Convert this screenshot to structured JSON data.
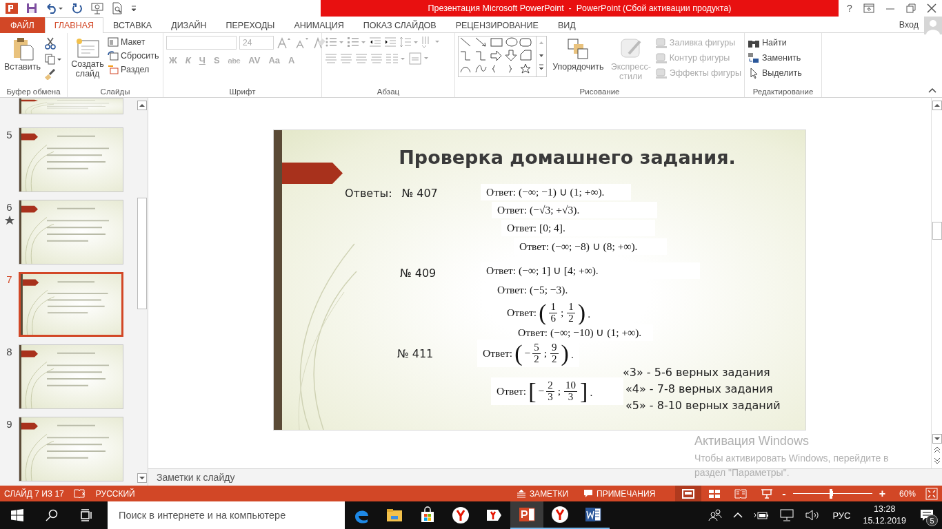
{
  "title_bar": {
    "title": "Презентация Microsoft PowerPoint  -  PowerPoint (Сбой активации продукта)",
    "help": "?"
  },
  "tabs": [
    {
      "label": "ФАЙЛ",
      "kind": "file",
      "selected": false
    },
    {
      "label": "ГЛАВНАЯ",
      "kind": "tab",
      "selected": true
    },
    {
      "label": "ВСТАВКА",
      "kind": "tab",
      "selected": false
    },
    {
      "label": "ДИЗАЙН",
      "kind": "tab",
      "selected": false
    },
    {
      "label": "ПЕРЕХОДЫ",
      "kind": "tab",
      "selected": false
    },
    {
      "label": "АНИМАЦИЯ",
      "kind": "tab",
      "selected": false
    },
    {
      "label": "ПОКАЗ СЛАЙДОВ",
      "kind": "tab",
      "selected": false
    },
    {
      "label": "РЕЦЕНЗИРОВАНИЕ",
      "kind": "tab",
      "selected": false
    },
    {
      "label": "ВИД",
      "kind": "tab",
      "selected": false
    }
  ],
  "account": {
    "label": "Вход"
  },
  "ribbon": {
    "clipboard": {
      "label": "Буфер обмена",
      "paste": "Вставить"
    },
    "slides": {
      "label": "Слайды",
      "new_slide": "Создать слайд",
      "layout": "Макет",
      "reset": "Сбросить",
      "section": "Раздел"
    },
    "font": {
      "label": "Шрифт",
      "disabled": true,
      "size": "24",
      "buttons": [
        "Ж",
        "К",
        "Ч",
        "S",
        "abc",
        "AV",
        "Aa",
        "A"
      ]
    },
    "paragraph": {
      "label": "Абзац",
      "disabled": true
    },
    "drawing": {
      "label": "Рисование",
      "arrange": "Упорядочить",
      "quick_styles": {
        "label": "Экспресс-стили",
        "disabled": true
      },
      "shape_tools": [
        {
          "label": "Заливка фигуры",
          "disabled": true
        },
        {
          "label": "Контур фигуры",
          "disabled": true
        },
        {
          "label": "Эффекты фигуры",
          "disabled": true
        }
      ]
    },
    "editing": {
      "label": "Редактирование",
      "find": "Найти",
      "replace": "Заменить",
      "select": "Выделить"
    }
  },
  "thumbnails": [
    {
      "kind": "partial",
      "selected": false
    },
    {
      "kind": "full",
      "number": "5",
      "animated": false,
      "selected": false
    },
    {
      "kind": "full",
      "number": "6",
      "animated": true,
      "selected": false
    },
    {
      "kind": "full",
      "number": "7",
      "animated": false,
      "selected": true
    },
    {
      "kind": "full",
      "number": "8",
      "animated": false,
      "selected": false
    },
    {
      "kind": "full",
      "number": "9",
      "animated": false,
      "selected": false
    }
  ],
  "slide": {
    "title": "Проверка домашнего задания.",
    "tasks": [
      {
        "prefix": "Ответы:",
        "number": "№ 407",
        "answers": [
          {
            "kind": "text",
            "text": "Ответ: (−∞; −1) ∪ (1; +∞)."
          },
          {
            "kind": "text",
            "text": "Ответ: (−√3; +√3)."
          },
          {
            "kind": "text",
            "text": "Ответ: [0; 4]."
          },
          {
            "kind": "text",
            "text": "Ответ: (−∞; −8) ∪ (8; +∞)."
          }
        ]
      },
      {
        "number": "№ 409",
        "answers": [
          {
            "kind": "text",
            "text": "Ответ: (−∞; 1] ∪ [4; +∞)."
          },
          {
            "kind": "text",
            "text": "Ответ: (−5; −3)."
          },
          {
            "kind": "fraction",
            "label": "Ответ:",
            "open": "(",
            "terms": [
              {
                "num": "1",
                "den": "6"
              },
              {
                "num": "1",
                "den": "2"
              }
            ],
            "separator": ";",
            "close": ")",
            "end": "."
          },
          {
            "kind": "text",
            "text": "Ответ: (−∞; −10) ∪ (1; +∞)."
          }
        ]
      },
      {
        "number": "№ 411",
        "answers": [
          {
            "kind": "fraction",
            "label": "Ответ:",
            "open": "(",
            "terms": [
              {
                "sign": "−",
                "num": "5",
                "den": "2"
              },
              {
                "num": "9",
                "den": "2"
              }
            ],
            "separator": ";",
            "close": ")",
            "end": "."
          },
          {
            "kind": "fraction",
            "label": "Ответ:",
            "open": "[",
            "terms": [
              {
                "sign": "−",
                "num": "2",
                "den": "3"
              },
              {
                "num": "10",
                "den": "3"
              }
            ],
            "separator": ";",
            "close": "]",
            "end": "."
          }
        ]
      }
    ],
    "grades": [
      "«3» - 5-6 верных задания",
      "«4» - 7-8 верных задания",
      "«5» - 8-10 верных заданий"
    ]
  },
  "notes_placeholder": "Заметки к слайду",
  "activation": {
    "title": "Активация Windows",
    "lines": [
      "Чтобы активировать Windows, перейдите в",
      "раздел \"Параметры\"."
    ]
  },
  "status_bar": {
    "slide": "СЛАЙД 7 ИЗ 17",
    "language": "РУССКИЙ",
    "notes": "ЗАМЕТКИ",
    "comments": "ПРИМЕЧАНИЯ",
    "views": [
      {
        "kind": "normal",
        "selected": true
      },
      {
        "kind": "sorter",
        "selected": false
      },
      {
        "kind": "reading",
        "selected": false
      },
      {
        "kind": "show",
        "selected": false
      }
    ],
    "zoom": {
      "minus": "-",
      "plus": "+",
      "level": 0.48,
      "value": "60%"
    }
  },
  "taskbar": {
    "search_placeholder": "Поиск в интернете и на компьютере",
    "apps": [
      {
        "kind": "edge",
        "running": false,
        "active": false
      },
      {
        "kind": "explorer",
        "running": false,
        "active": false
      },
      {
        "kind": "store",
        "running": false,
        "active": false
      },
      {
        "kind": "browser",
        "running": false,
        "active": false
      },
      {
        "kind": "yandex",
        "running": false,
        "active": false
      },
      {
        "kind": "powerpoint",
        "running": true,
        "active": true
      },
      {
        "kind": "browser",
        "running": true,
        "active": false
      },
      {
        "kind": "word",
        "running": true,
        "active": false
      }
    ],
    "language": "РУС",
    "time": "13:28",
    "date": "15.12.2019",
    "notifications": "5"
  }
}
